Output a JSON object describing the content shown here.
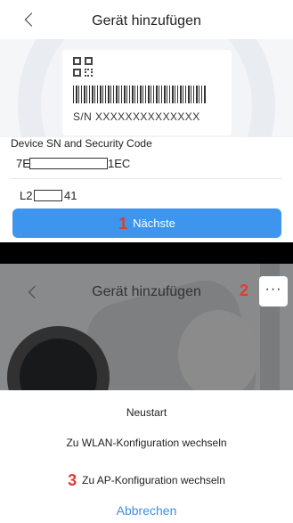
{
  "screen1": {
    "title": "Gerät hinzufügen",
    "sn_label": "S/N  XXXXXXXXXXXXXX",
    "section_title": "Device SN and Security Code",
    "serial_prefix": "7E",
    "serial_suffix": "1EC",
    "code_prefix": "L2",
    "code_suffix": "41",
    "next_button": "Nächste",
    "step_1": "1"
  },
  "screen2": {
    "title": "Gerät hinzufügen",
    "more_button": "···",
    "step_2": "2",
    "menu": {
      "restart": "Neustart",
      "wlan_config": "Zu WLAN-Konfiguration wechseln",
      "ap_config": "Zu AP-Konfiguration wechseln",
      "step_3": "3",
      "cancel": "Abbrechen"
    }
  },
  "colors": {
    "accent_blue": "#3d95ee",
    "step_red": "#e23b2f"
  }
}
